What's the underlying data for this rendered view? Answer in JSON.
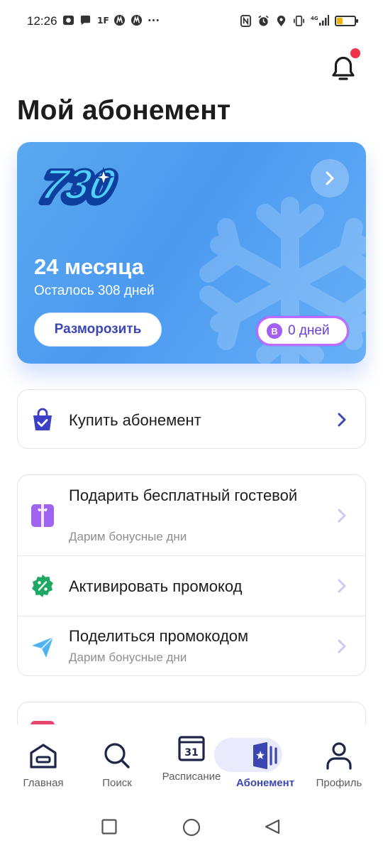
{
  "status_bar": {
    "time": "12:26",
    "left_icons": [
      "photo-icon",
      "chat-icon",
      "app-icon",
      "app-icon",
      "app-icon",
      "more-icon"
    ],
    "right_icons": [
      "nfc-icon",
      "alarm-icon",
      "location-icon",
      "vibrate-icon",
      "signal-icon",
      "battery-icon"
    ],
    "network": "4G",
    "battery_level": 0.3
  },
  "header": {
    "title": "Мой абонемент",
    "notification_dot": true
  },
  "subscription_card": {
    "logo_text": "730",
    "plan_name": "24 месяца",
    "remaining": "Осталось 308 дней",
    "unfreeze_label": "Разморозить",
    "freeze_badge_icon_letter": "B",
    "freeze_badge_text": "0 дней"
  },
  "buy_card": {
    "title": "Купить абонемент"
  },
  "actions": [
    {
      "title": "Подарить бесплатный гостевой",
      "subtitle": "Дарим бонусные дни"
    },
    {
      "title": "Активировать промокод",
      "subtitle": ""
    },
    {
      "title": "Поделиться промокодом",
      "subtitle": "Дарим бонусные дни"
    }
  ],
  "bottom_nav": {
    "items": [
      {
        "label": "Главная",
        "icon": "home-icon"
      },
      {
        "label": "Поиск",
        "icon": "search-icon"
      },
      {
        "label": "Расписание",
        "icon": "calendar-icon",
        "icon_text": "31"
      },
      {
        "label": "Абонемент",
        "icon": "pass-icon",
        "active": true
      },
      {
        "label": "Профиль",
        "icon": "profile-icon"
      }
    ]
  },
  "colors": {
    "accent": "#3b46b2",
    "card_blue": "#4b9af0",
    "notification_red": "#f0334a",
    "freeze_purple": "#a45ff0"
  }
}
